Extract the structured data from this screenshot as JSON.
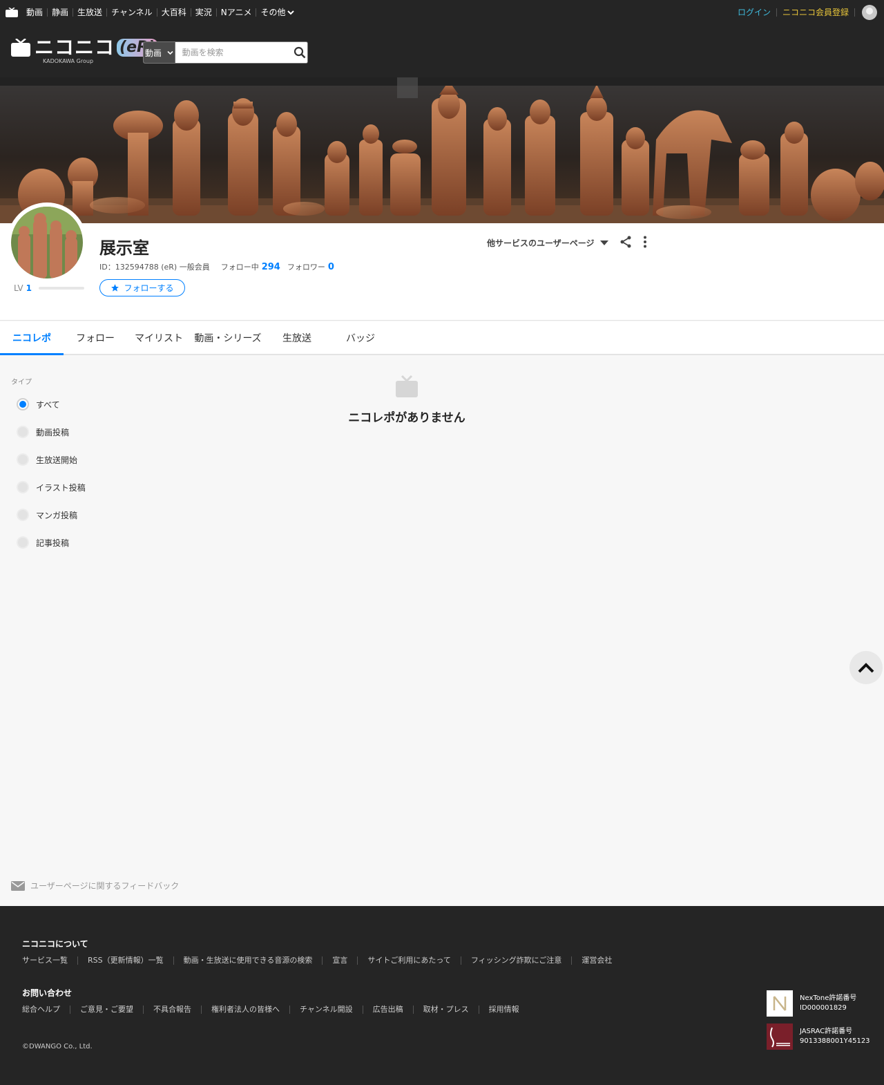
{
  "topbar": {
    "nav": [
      "動画",
      "静画",
      "生放送",
      "チャンネル",
      "大百科",
      "実況",
      "Nアニメ",
      "その他"
    ],
    "login": "ログイン",
    "register": "ニコニコ会員登録"
  },
  "header": {
    "logo_text": "ニコニコ",
    "logo_er": "(eR)",
    "logo_sub": "KADOKAWA Group",
    "search_type": "動画",
    "search_placeholder": "動画を検索"
  },
  "profile": {
    "name": "展示室",
    "id_text": "ID：132594788 (eR) 一般会員",
    "following_label": "フォロー中",
    "following_count": "294",
    "followers_label": "フォロワー",
    "followers_count": "0",
    "level_label": "LV",
    "level": "1",
    "follow_button": "フォローする",
    "other_services": "他サービスのユーザーページ"
  },
  "tabs": [
    "ニコレポ",
    "フォロー",
    "マイリスト",
    "動画・シリーズ",
    "生放送",
    "バッジ"
  ],
  "filter": {
    "title": "タイプ",
    "options": [
      "すべて",
      "動画投稿",
      "生放送開始",
      "イラスト投稿",
      "マンガ投稿",
      "記事投稿"
    ],
    "selected": "すべて"
  },
  "empty_state": "ニコレポがありません",
  "feedback": "ユーザーページに関するフィードバック",
  "footer": {
    "about_title": "ニコニコについて",
    "about_links": [
      "サービス一覧",
      "RSS（更新情報）一覧",
      "動画・生放送に使用できる音源の検索",
      "宣言",
      "サイトご利用にあたって",
      "フィッシング詐欺にご注意",
      "運営会社"
    ],
    "contact_title": "お問い合わせ",
    "contact_links": [
      "総合ヘルプ",
      "ご意見・ご要望",
      "不具合報告",
      "権利者法人の皆様へ",
      "チャンネル開設",
      "広告出稿",
      "取材・プレス",
      "採用情報"
    ],
    "copyright": "©DWANGO Co., Ltd.",
    "nextone_label": "NexTone許諾番号",
    "nextone_id": "ID000001829",
    "jasrac_label": "JASRAC許諾番号",
    "jasrac_id": "9013388001Y45123"
  },
  "colors": {
    "accent": "#0080ff",
    "dark": "#252525",
    "login": "#3fbadc",
    "register": "#e7c43a"
  }
}
